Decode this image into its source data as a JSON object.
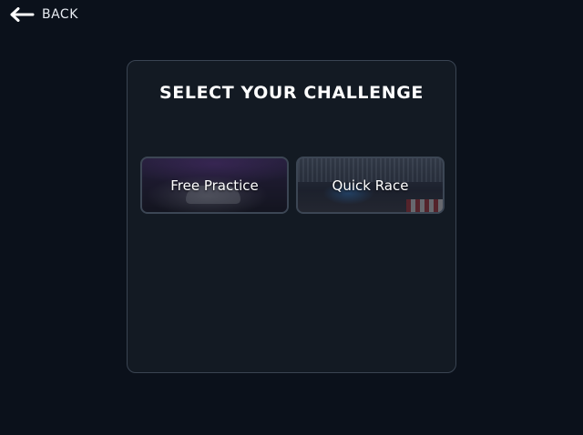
{
  "nav": {
    "back_label": "BACK",
    "back_icon": "arrow-left-icon"
  },
  "panel": {
    "title": "SELECT YOUR CHALLENGE",
    "options": [
      {
        "label": "Free Practice"
      },
      {
        "label": "Quick Race"
      }
    ]
  },
  "colors": {
    "background": "#0b111b",
    "panel": "#131a23",
    "panel_border": "#3a4452",
    "text": "#ffffff"
  }
}
